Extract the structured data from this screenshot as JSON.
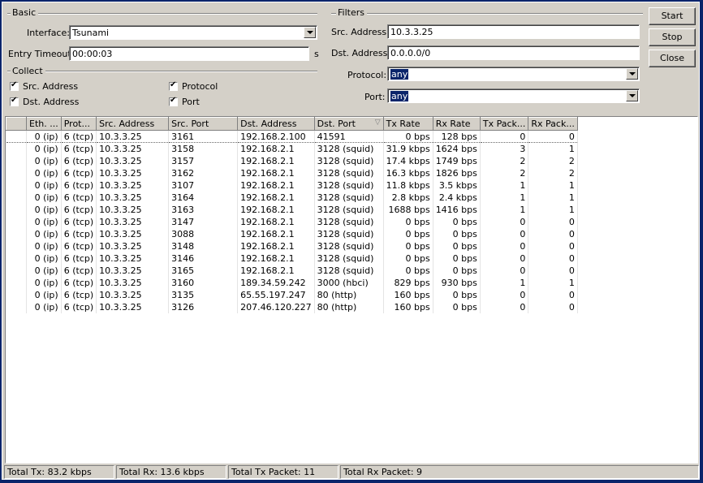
{
  "basic": {
    "title": "Basic",
    "interface_label": "Interface:",
    "interface_value": "Tsunami",
    "entry_timeout_label": "Entry Timeout:",
    "entry_timeout_value": "00:00:03",
    "entry_timeout_unit": "s"
  },
  "collect": {
    "title": "Collect",
    "src_address_label": "Src. Address",
    "dst_address_label": "Dst. Address",
    "protocol_label": "Protocol",
    "port_label": "Port"
  },
  "filters": {
    "title": "Filters",
    "src_address_label": "Src. Address:",
    "src_address_value": "10.3.3.25",
    "dst_address_label": "Dst. Address:",
    "dst_address_value": "0.0.0.0/0",
    "protocol_label": "Protocol:",
    "protocol_value": "any",
    "port_label": "Port:",
    "port_value": "any"
  },
  "buttons": {
    "start": "Start",
    "stop": "Stop",
    "close": "Close"
  },
  "table": {
    "columns": [
      "Eth. ...",
      "Prot...",
      "Src. Address",
      "Src. Port",
      "Dst. Address",
      "Dst. Port",
      "Tx Rate",
      "Rx Rate",
      "Tx Pack...",
      "Rx Pack..."
    ],
    "sort_indicator": "▽",
    "rows": [
      [
        "0 (ip)",
        "6 (tcp)",
        "10.3.3.25",
        "3161",
        "192.168.2.100",
        "41591",
        "0 bps",
        "128 bps",
        "0",
        "0"
      ],
      [
        "0 (ip)",
        "6 (tcp)",
        "10.3.3.25",
        "3158",
        "192.168.2.1",
        "3128 (squid)",
        "31.9 kbps",
        "1624 bps",
        "3",
        "1"
      ],
      [
        "0 (ip)",
        "6 (tcp)",
        "10.3.3.25",
        "3157",
        "192.168.2.1",
        "3128 (squid)",
        "17.4 kbps",
        "1749 bps",
        "2",
        "2"
      ],
      [
        "0 (ip)",
        "6 (tcp)",
        "10.3.3.25",
        "3162",
        "192.168.2.1",
        "3128 (squid)",
        "16.3 kbps",
        "1826 bps",
        "2",
        "2"
      ],
      [
        "0 (ip)",
        "6 (tcp)",
        "10.3.3.25",
        "3107",
        "192.168.2.1",
        "3128 (squid)",
        "11.8 kbps",
        "3.5 kbps",
        "1",
        "1"
      ],
      [
        "0 (ip)",
        "6 (tcp)",
        "10.3.3.25",
        "3164",
        "192.168.2.1",
        "3128 (squid)",
        "2.8 kbps",
        "2.4 kbps",
        "1",
        "1"
      ],
      [
        "0 (ip)",
        "6 (tcp)",
        "10.3.3.25",
        "3163",
        "192.168.2.1",
        "3128 (squid)",
        "1688 bps",
        "1416 bps",
        "1",
        "1"
      ],
      [
        "0 (ip)",
        "6 (tcp)",
        "10.3.3.25",
        "3147",
        "192.168.2.1",
        "3128 (squid)",
        "0 bps",
        "0 bps",
        "0",
        "0"
      ],
      [
        "0 (ip)",
        "6 (tcp)",
        "10.3.3.25",
        "3088",
        "192.168.2.1",
        "3128 (squid)",
        "0 bps",
        "0 bps",
        "0",
        "0"
      ],
      [
        "0 (ip)",
        "6 (tcp)",
        "10.3.3.25",
        "3148",
        "192.168.2.1",
        "3128 (squid)",
        "0 bps",
        "0 bps",
        "0",
        "0"
      ],
      [
        "0 (ip)",
        "6 (tcp)",
        "10.3.3.25",
        "3146",
        "192.168.2.1",
        "3128 (squid)",
        "0 bps",
        "0 bps",
        "0",
        "0"
      ],
      [
        "0 (ip)",
        "6 (tcp)",
        "10.3.3.25",
        "3165",
        "192.168.2.1",
        "3128 (squid)",
        "0 bps",
        "0 bps",
        "0",
        "0"
      ],
      [
        "0 (ip)",
        "6 (tcp)",
        "10.3.3.25",
        "3160",
        "189.34.59.242",
        "3000 (hbci)",
        "829 bps",
        "930 bps",
        "1",
        "1"
      ],
      [
        "0 (ip)",
        "6 (tcp)",
        "10.3.3.25",
        "3135",
        "65.55.197.247",
        "80 (http)",
        "160 bps",
        "0 bps",
        "0",
        "0"
      ],
      [
        "0 (ip)",
        "6 (tcp)",
        "10.3.3.25",
        "3126",
        "207.46.120.227",
        "80 (http)",
        "160 bps",
        "0 bps",
        "0",
        "0"
      ]
    ]
  },
  "status": {
    "total_tx": "Total Tx: 83.2 kbps",
    "total_rx": "Total Rx: 13.6 kbps",
    "total_tx_packet": "Total Tx Packet: 11",
    "total_rx_packet": "Total Rx Packet: 9"
  },
  "colors": {
    "frame": "#0a246a",
    "face": "#d4d0c8",
    "selection": "#0a246a"
  }
}
